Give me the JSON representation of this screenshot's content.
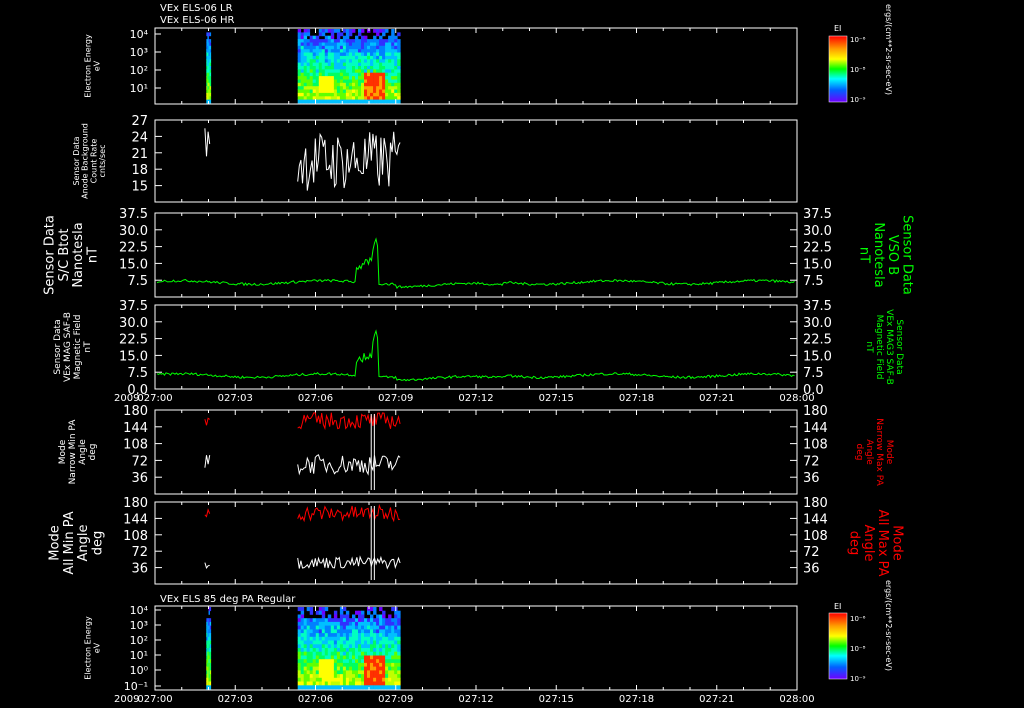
{
  "titles": {
    "top_line1": "VEx ELS-06 LR",
    "top_line2": "VEx ELS-06 HR",
    "bottom": "VEx ELS 85 deg PA Regular"
  },
  "colors": {
    "background": "#000000",
    "axes": "#ffffff",
    "green_series": "#00ff00",
    "red_series": "#ff0000",
    "white_series": "#ffffff"
  },
  "colorbars": [
    {
      "label": "EI",
      "ticks": [
        "10⁻⁶",
        "10⁻⁸",
        "10⁻⁹"
      ],
      "side_label": "ergs/(cm**2-sr-sec-eV)"
    },
    {
      "label": "EI",
      "ticks": [
        "10⁻⁶",
        "10⁻⁸",
        "10⁻⁹"
      ],
      "side_label": "ergs/(cm**2-sr-sec-eV)"
    }
  ],
  "x_axis": {
    "year_label": "2009",
    "ticks": [
      "027:00",
      "027:03",
      "027:06",
      "027:09",
      "027:12",
      "027:15",
      "027:18",
      "027:21",
      "028:00"
    ]
  },
  "chart_data": [
    {
      "type": "heatmap",
      "id": "spectrogram-top",
      "ylabel": [
        "Electron Energy",
        "eV"
      ],
      "yscale": "log",
      "ytick_labels": [
        "10⁴",
        "10³",
        "10²",
        "10¹"
      ],
      "data_blocks": [
        {
          "t_start": "027:01:55",
          "t_end": "027:02:05"
        },
        {
          "t_start": "027:05:20",
          "t_end": "027:09:10"
        }
      ]
    },
    {
      "type": "line",
      "id": "anode-background",
      "ylabel": [
        "Sensor Data",
        "Anode Background",
        "Count Rate",
        "cnts/sec"
      ],
      "ylim": [
        12,
        27
      ],
      "ytick_labels": [
        "27",
        "24",
        "21",
        "18",
        "15"
      ],
      "series": [
        {
          "color": "#ffffff",
          "segments": [
            {
              "x": [
                "027:01:52",
                "027:02:05"
              ],
              "y_range": [
                19,
                26
              ]
            },
            {
              "x": [
                "027:05:20",
                "027:09:10"
              ],
              "y_range": [
                14,
                25
              ]
            }
          ]
        }
      ]
    },
    {
      "type": "line",
      "id": "btot",
      "ylabel": [
        "Sensor Data",
        "S/C Btot",
        "Nanotesla",
        "nT"
      ],
      "ylabel_right": [
        "Sensor Data",
        "VSO B",
        "Nanotesla",
        "nT"
      ],
      "ylim": [
        0,
        37.5
      ],
      "ytick_labels": [
        "37.5",
        "30.0",
        "22.5",
        "15.0",
        "7.5"
      ],
      "series": [
        {
          "color": "#00ff00",
          "baseline": 6.5,
          "peak": {
            "x": "027:08:15",
            "y": 26.5
          }
        }
      ]
    },
    {
      "type": "line",
      "id": "mag-field",
      "ylabel": [
        "Sensor Data",
        "VEx MAG SAF-B",
        "Magnetic Field",
        "nT"
      ],
      "ylabel_right": [
        "Sensor Data",
        "VEx MAG3 SAF-B",
        "Magnetic Field",
        "nT"
      ],
      "ylim": [
        0,
        37.5
      ],
      "ytick_labels": [
        "37.5",
        "30.0",
        "22.5",
        "15.0",
        "7.5",
        "0.0"
      ],
      "series": [
        {
          "color": "#00ff00",
          "baseline": 6.0,
          "peak": {
            "x": "027:08:15",
            "y": 26.5
          }
        }
      ]
    },
    {
      "type": "line",
      "id": "narrow-pa",
      "ylabel": [
        "Mode",
        "Narrow Min PA",
        "Angle",
        "deg"
      ],
      "ylabel_right": [
        "Mode",
        "Narrow Max PA",
        "Angle",
        "deg"
      ],
      "ylim": [
        0,
        180
      ],
      "ytick_labels": [
        "180",
        "144",
        "108",
        "72",
        "36"
      ],
      "series": [
        {
          "color": "#ff0000",
          "y_range": [
            120,
            175
          ]
        },
        {
          "color": "#ffffff",
          "y_range": [
            20,
            85
          ]
        }
      ]
    },
    {
      "type": "line",
      "id": "all-pa",
      "ylabel": [
        "Mode",
        "All Min PA",
        "Angle",
        "deg"
      ],
      "ylabel_right": [
        "Mode",
        "All Max PA",
        "Angle",
        "deg"
      ],
      "ylim": [
        0,
        180
      ],
      "ytick_labels": [
        "180",
        "144",
        "108",
        "72",
        "36"
      ],
      "series": [
        {
          "color": "#ff0000",
          "y_range": [
            120,
            172
          ]
        },
        {
          "color": "#ffffff",
          "y_range": [
            20,
            60
          ]
        }
      ]
    },
    {
      "type": "heatmap",
      "id": "spectrogram-bottom",
      "ylabel": [
        "Electron Energy",
        "eV"
      ],
      "yscale": "log",
      "ytick_labels": [
        "10⁴",
        "10³",
        "10²",
        "10¹",
        "10⁰",
        "10⁻¹"
      ],
      "data_blocks": [
        {
          "t_start": "027:01:55",
          "t_end": "027:02:05"
        },
        {
          "t_start": "027:05:20",
          "t_end": "027:09:10"
        }
      ]
    }
  ]
}
